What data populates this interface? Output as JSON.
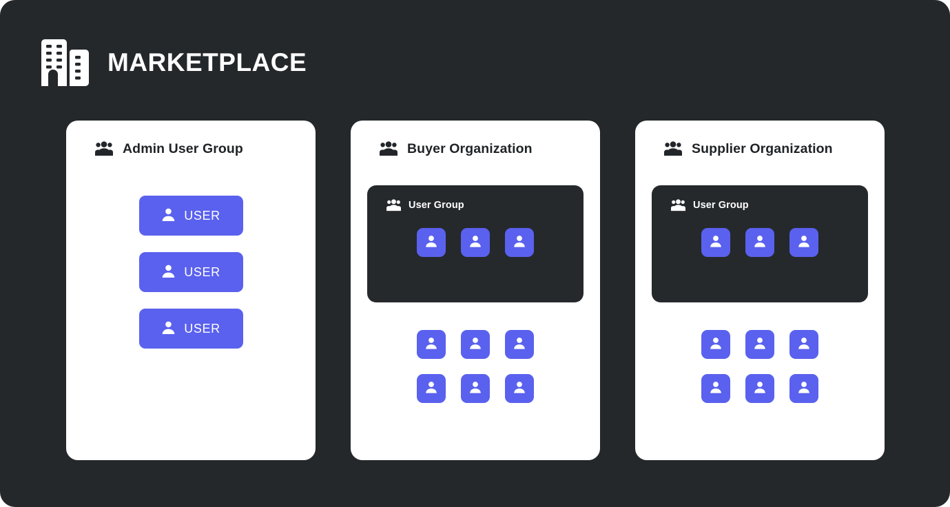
{
  "brand": {
    "name": "MARKETPLACE",
    "logo_icon": "buildings-icon",
    "text_color": "#ffffff"
  },
  "theme": {
    "page_background": "#24282b",
    "card_background": "#ffffff",
    "panel_background": "#25292c",
    "accent": "#5a61ee",
    "heading_color": "#1f2326"
  },
  "cards": [
    {
      "title": "Admin User Group",
      "icon": "users-group-icon",
      "layout": "user-buttons",
      "user_buttons": [
        {
          "label": "USER",
          "icon": "person-icon"
        },
        {
          "label": "USER",
          "icon": "person-icon"
        },
        {
          "label": "USER",
          "icon": "person-icon"
        }
      ]
    },
    {
      "title": "Buyer Organization",
      "icon": "users-group-icon",
      "layout": "group-panel",
      "group_panel": {
        "title": "User Group",
        "icon": "users-group-icon",
        "avatar_count": 3
      },
      "avatar_rows": [
        3,
        3
      ]
    },
    {
      "title": "Supplier Organization",
      "icon": "users-group-icon",
      "layout": "group-panel",
      "group_panel": {
        "title": "User Group",
        "icon": "users-group-icon",
        "avatar_count": 3
      },
      "avatar_rows": [
        3,
        3
      ]
    }
  ]
}
